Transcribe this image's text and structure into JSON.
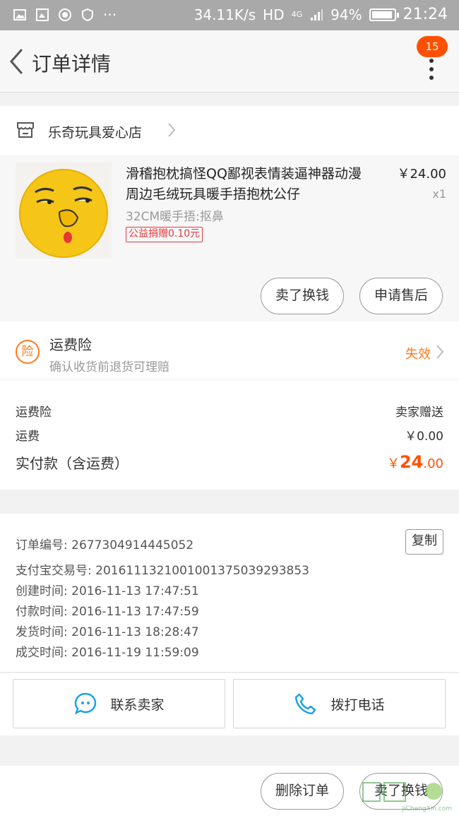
{
  "status_bar": {
    "network_speed": "34.11K/s",
    "hd": "HD",
    "signal": "4G",
    "battery_text": "94%",
    "battery_level": 0.94,
    "time": "21:24"
  },
  "header": {
    "title": "订单详情",
    "badge_count": "15"
  },
  "shop": {
    "name": "乐奇玩具爱心店"
  },
  "product": {
    "title": "滑稽抱枕搞怪QQ鄙视表情装逼神器动漫周边毛绒玩具暖手捂抱枕公仔",
    "sku": "32CM暖手捂:抠鼻",
    "tag": "公益捐赠0.10元",
    "price": "￥24.00",
    "qty": "x1",
    "buttons": {
      "sell": "卖了换钱",
      "aftersale": "申请售后"
    }
  },
  "insurance": {
    "icon_text": "险",
    "title": "运费险",
    "subtitle": "确认收货前退货可理赔",
    "status": "失效"
  },
  "fees": {
    "rows": [
      {
        "label": "运费险",
        "value": "卖家赠送"
      },
      {
        "label": "运费",
        "value": "￥0.00"
      }
    ],
    "total_label": "实付款（含运费）",
    "total_currency": "￥",
    "total_int": "24",
    "total_dec": ".00"
  },
  "details": {
    "copy_label": "复制",
    "lines": [
      "订单编号: 2677304914445052",
      "支付宝交易号: 2016111321001001375039293853",
      "创建时间: 2016-11-13 17:47:51",
      "付款时间: 2016-11-13 17:47:59",
      "发货时间: 2016-11-13 18:28:47",
      "成交时间: 2016-11-19 11:59:09"
    ]
  },
  "contact": {
    "seller": "联系卖家",
    "phone": "拨打电话"
  },
  "bottom": {
    "delete": "删除订单",
    "sell": "卖了换钱"
  },
  "watermark": {
    "text": "JiChengXin.com"
  },
  "colors": {
    "accent": "#ff5000",
    "insurance": "#ff7a1a",
    "tag": "#e4393c",
    "contact_icon": "#1aa3e8"
  }
}
